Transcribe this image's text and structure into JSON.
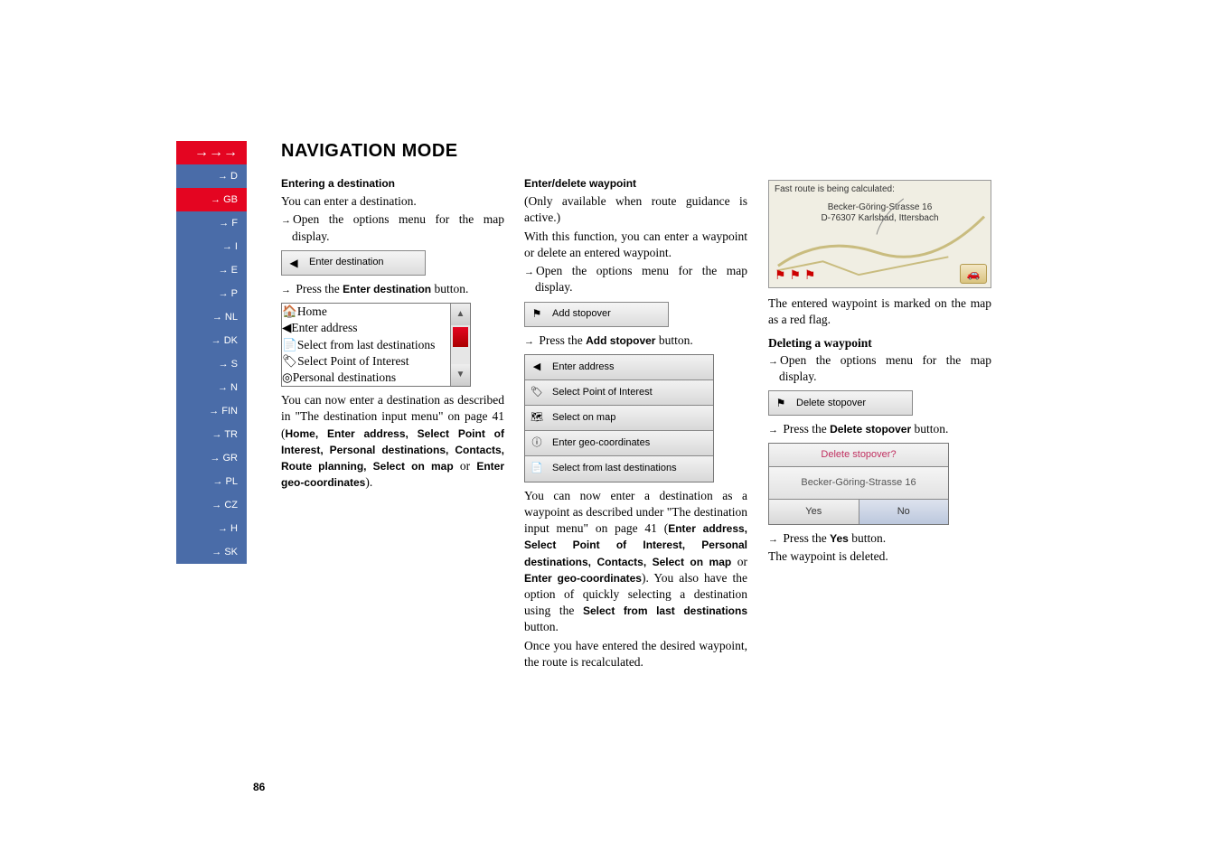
{
  "title": "NAVIGATION MODE",
  "arrows": "→→→",
  "side_nav": [
    {
      "label": "→ D",
      "cls": "blue"
    },
    {
      "label": "→ GB",
      "cls": "red"
    },
    {
      "label": "→ F",
      "cls": "blue"
    },
    {
      "label": "→ I",
      "cls": "blue"
    },
    {
      "label": "→ E",
      "cls": "blue"
    },
    {
      "label": "→ P",
      "cls": "blue"
    },
    {
      "label": "→ NL",
      "cls": "blue"
    },
    {
      "label": "→ DK",
      "cls": "blue"
    },
    {
      "label": "→ S",
      "cls": "blue"
    },
    {
      "label": "→ N",
      "cls": "blue"
    },
    {
      "label": "→ FIN",
      "cls": "blue"
    },
    {
      "label": "→ TR",
      "cls": "blue"
    },
    {
      "label": "→ GR",
      "cls": "blue"
    },
    {
      "label": "→ PL",
      "cls": "blue"
    },
    {
      "label": "→ CZ",
      "cls": "blue"
    },
    {
      "label": "→ H",
      "cls": "blue"
    },
    {
      "label": "→ SK",
      "cls": "blue"
    }
  ],
  "col1": {
    "h1": "Entering a destination",
    "t1": "You can enter a destination.",
    "t2": "Open the options menu for the map display.",
    "btn1_label": "Enter destination",
    "t3_pre": "Press the ",
    "t3_bold": "Enter destination",
    "t3_post": " button.",
    "menu": [
      {
        "icon": "🏠",
        "label": "Home"
      },
      {
        "icon": "◀",
        "label": "Enter address"
      },
      {
        "icon": "📄",
        "label": "Select from last destinations"
      },
      {
        "icon": "🏷",
        "label": "Select Point of Interest"
      },
      {
        "icon": "◎",
        "label": "Personal destinations"
      }
    ],
    "para_pre": "You can now enter a destination as described in \"The destination input menu\" on page 41 (",
    "para_bold": "Home, Enter address, Select Point of Interest, Personal destinations, Contacts, Route planning, Select on map",
    "para_mid": " or ",
    "para_bold2": "Enter geo-coordinates",
    "para_post": ")."
  },
  "col2": {
    "h1": "Enter/delete waypoint",
    "t1": "(Only available when route guidance is active.)",
    "t2": "With this function, you can enter a waypoint or delete an entered waypoint.",
    "t3": "Open the options menu for the map display.",
    "btn1_label": "Add stopover",
    "t4_pre": "Press the ",
    "t4_bold": "Add stopover",
    "t4_post": " button.",
    "menu": [
      {
        "icon": "◀",
        "label": "Enter address"
      },
      {
        "icon": "🏷",
        "label": "Select Point of Interest"
      },
      {
        "icon": "🗺",
        "label": "Select on map"
      },
      {
        "icon": "ⓘ",
        "label": "Enter geo-coordinates"
      },
      {
        "icon": "📄",
        "label": "Select from last destinations"
      }
    ],
    "para_pre": "You can now enter a destination as a waypoint as described under \"The destination input menu\" on page 41 (",
    "para_bold": "Enter address, Select Point of Interest, Personal destinations, Contacts, Select on map",
    "para_mid": " or ",
    "para_bold2": "Enter geo-coordinates",
    "para_post": "). You also have the option of quickly selecting a destination using the ",
    "para_bold3": "Select from last destinations",
    "para_post2": " button.",
    "t5": "Once you have entered the desired waypoint, the route is recalculated."
  },
  "col3": {
    "map_hdr": "Fast route is being calculated:",
    "map_addr1": "Becker-Göring-Strasse 16",
    "map_addr2": "D-76307 Karlsbad, Ittersbach",
    "t1": "The entered waypoint is marked on the map as a red flag.",
    "h2": "Deleting a waypoint",
    "t2": "Open the options menu for the map display.",
    "btn1_label": "Delete stopover",
    "t3_pre": "Press the ",
    "t3_bold": "Delete stopover",
    "t3_post": " button.",
    "dialog_hdr": "Delete stopover?",
    "dialog_sub": "Becker-Göring-Strasse 16",
    "dialog_yes": "Yes",
    "dialog_no": "No",
    "t4_pre": "Press the ",
    "t4_bold": "Yes",
    "t4_post": " button.",
    "t5": "The waypoint is deleted."
  },
  "page_num": "86"
}
